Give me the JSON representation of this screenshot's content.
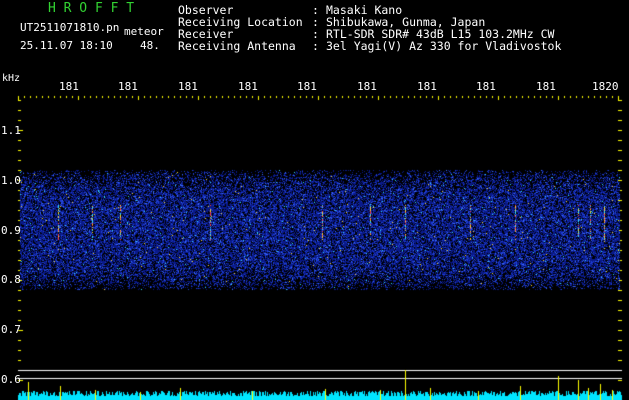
{
  "header": {
    "brand": "H R O F F T",
    "file_name": "UT2511071810.pn",
    "meteor_tag": "meteor",
    "date_time": "25.11.07 18:10",
    "count": "48."
  },
  "info": [
    {
      "label": "Observer",
      "value": "Masaki Kano"
    },
    {
      "label": "Receiving Location",
      "value": "Shibukawa, Gunma, Japan"
    },
    {
      "label": "Receiver",
      "value": "RTL-SDR SDR# 43dB L15 103.2MHz CW"
    },
    {
      "label": "Receiving Antenna",
      "value": "3el Yagi(V) Az 330 for Vladivostok"
    }
  ],
  "separator": ":",
  "axes": {
    "y_unit": "kHz",
    "y_ticks": [
      "1.1",
      "1.0",
      "0.9",
      "0.8",
      "0.7",
      "0.6"
    ],
    "x_ticks": [
      "181",
      "181",
      "181",
      "181",
      "181",
      "181",
      "181",
      "181",
      "181",
      "1820"
    ]
  },
  "colors": {
    "background": "#000000",
    "text": "#ffffff",
    "brand": "#32d232",
    "tick_marks": "#ffff00",
    "signal_band": "#1a3fd0",
    "power_trace": "#00e5ff",
    "meteor_spikes": "#ffff00",
    "ref_lines": "#ffffff"
  }
}
